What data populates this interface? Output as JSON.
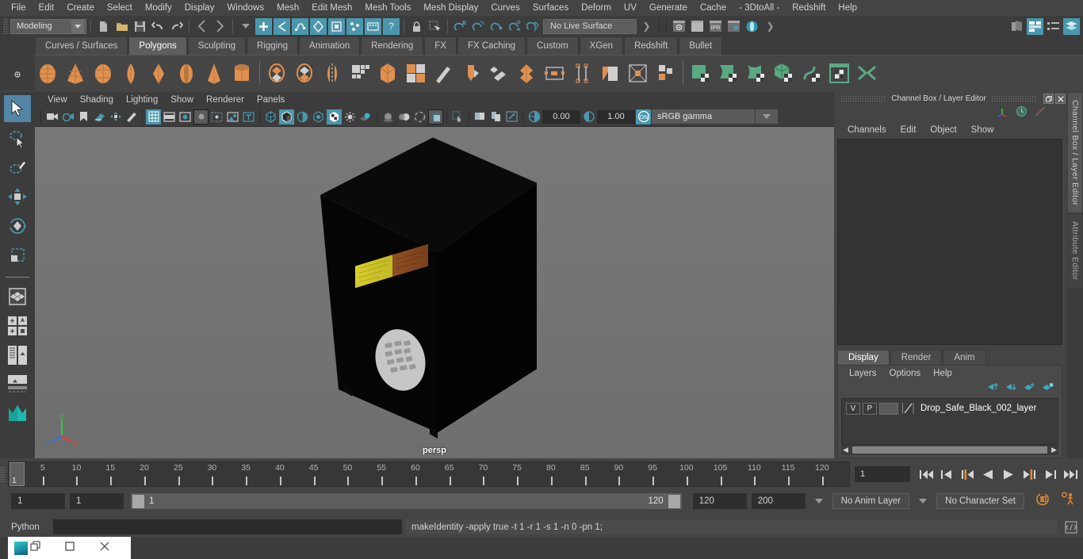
{
  "app": {
    "title": "Autodesk Maya"
  },
  "menubar": {
    "items": [
      "File",
      "Edit",
      "Create",
      "Select",
      "Modify",
      "Display",
      "Windows",
      "Mesh",
      "Edit Mesh",
      "Mesh Tools",
      "Mesh Display",
      "Curves",
      "Surfaces",
      "Deform",
      "UV",
      "Generate",
      "Cache",
      "- 3DtoAll -",
      "Redshift",
      "Help"
    ]
  },
  "statusline": {
    "menuset": "Modeling",
    "live_surface": "No Live Surface",
    "icons": [
      "new-scene-icon",
      "open-scene-icon",
      "save-scene-icon",
      "undo-icon",
      "redo-icon",
      "select-by-hierarchy-icon",
      "select-by-object-icon",
      "select-by-component-icon",
      "mode-dropdown-icon",
      "select-handles-icon",
      "select-points-icon",
      "select-lines-icon",
      "select-faces-icon",
      "select-uvs-icon",
      "select-all-icon",
      "select-misc-icon",
      "select-help-icon",
      "lock-icon",
      "select-region-icon",
      "snap-grid-icon",
      "snap-curve-icon",
      "snap-point-icon",
      "snap-projected-icon",
      "snap-view-icon",
      "render-current-frame-icon",
      "render-sequence-icon",
      "ipr-render-icon",
      "render-settings-icon",
      "hypershade-icon",
      "outliner-toggle-icon",
      "attribute-editor-toggle-icon",
      "tool-settings-toggle-icon",
      "channel-box-toggle-icon"
    ]
  },
  "shelf": {
    "tabs": [
      "Curves / Surfaces",
      "Polygons",
      "Sculpting",
      "Rigging",
      "Animation",
      "Rendering",
      "FX",
      "FX Caching",
      "Custom",
      "XGen",
      "Redshift",
      "Bullet"
    ],
    "active_tab": "Polygons",
    "icons": [
      "poly-sphere-icon",
      "poly-cone-icon",
      "poly-cube-icon",
      "poly-cylinder-icon",
      "poly-plane-icon",
      "poly-torus-icon",
      "poly-pyramid-icon",
      "poly-pipe-icon",
      "poly-combine-icon",
      "poly-separate-icon",
      "poly-mirror-icon",
      "poly-smooth-icon",
      "poly-boolean-icon",
      "poly-reduce-icon",
      "poly-extrude-icon",
      "poly-bevel-icon",
      "poly-multicut-icon",
      "poly-target-weld-icon",
      "poly-quad-draw-icon",
      "poly-crease-icon",
      "poly-transfer-attrs-icon",
      "poly-uv-icon",
      "uv-editor-icon",
      "uv-snapshot-icon",
      "uv-planar-icon",
      "uv-cylindrical-icon",
      "uv-spherical-icon",
      "uv-automatic-icon",
      "uv-layout-icon",
      "uv-unfold-icon"
    ]
  },
  "toolbox": {
    "tools": [
      "select-tool",
      "lasso-select-tool",
      "paint-select-tool",
      "move-tool",
      "rotate-tool",
      "scale-tool",
      "last-tool-used",
      "single-view-layout",
      "four-view-layout",
      "persp-outliner-layout",
      "persp-graph-layout",
      "hypershade-layout",
      "maya-logo"
    ],
    "active": "select-tool"
  },
  "viewport": {
    "menu": [
      "View",
      "Shading",
      "Lighting",
      "Show",
      "Renderer",
      "Panels"
    ],
    "camera_label": "persp",
    "exposure": "0.00",
    "gamma": "1.00",
    "color_management": "sRGB gamma",
    "tool_icons": [
      "select-camera-icon",
      "bookmark-camera-icon",
      "image-plane-icon",
      "two-d-pan-zoom-icon",
      "grease-pencil-icon",
      "grid-toggle-icon",
      "film-gate-icon",
      "resolution-gate-icon",
      "gate-mask-icon",
      "film-origin-icon",
      "safe-action-icon",
      "xray-text-icon",
      "wireframe-icon",
      "smooth-shade-icon",
      "shaded-wireframe-icon",
      "textured-icon",
      "use-default-material-icon",
      "lighting-icon",
      "shadows-icon",
      "ao-icon",
      "motion-blur-icon",
      "multisample-icon",
      "isolate-select-icon",
      "xray-icon",
      "xray-joints-icon",
      "xray-active-components-icon",
      "exposure-icon",
      "gamma-icon",
      "color-management-icon"
    ],
    "axis_gizmo": {
      "x": "x",
      "y": "y",
      "z": "z"
    }
  },
  "channelbox": {
    "panel_title": "Channel Box / Layer Editor",
    "menu": [
      "Channels",
      "Edit",
      "Object",
      "Show"
    ],
    "toolbar_icons": [
      "axis-gizmo-icon",
      "clock-icon",
      "slash-icon"
    ],
    "window_buttons": [
      "restore-icon",
      "close-icon"
    ],
    "content": ""
  },
  "layer_editor": {
    "tabs": [
      "Display",
      "Render",
      "Anim"
    ],
    "active_tab": "Display",
    "menu": [
      "Layers",
      "Options",
      "Help"
    ],
    "buttons": [
      "move-layer-up-icon",
      "move-layer-down-icon",
      "new-layer-icon",
      "new-layer-from-selected-icon"
    ],
    "layers": [
      {
        "visibility": "V",
        "playback": "P",
        "shading": "",
        "name": "Drop_Safe_Black_002_layer"
      }
    ]
  },
  "right_tabs": [
    {
      "label": "Channel Box / Layer Editor",
      "active": true
    },
    {
      "label": "Attribute Editor",
      "active": false
    }
  ],
  "timeslider": {
    "start_tick": 1,
    "ticks": [
      5,
      10,
      15,
      20,
      25,
      30,
      35,
      40,
      45,
      50,
      55,
      60,
      65,
      70,
      75,
      80,
      85,
      90,
      95,
      100,
      105,
      110,
      115,
      120
    ],
    "current_frame_label": "1",
    "current_frame_field": "1",
    "playback_buttons": [
      "go-to-start-icon",
      "step-back-keyframe-icon",
      "step-back-frame-icon",
      "play-backwards-icon",
      "play-forwards-icon",
      "step-forward-frame-icon",
      "step-forward-keyframe-icon",
      "go-to-end-icon"
    ]
  },
  "rangeslider": {
    "anim_start": "1",
    "playback_start": "1",
    "range_left_label": "1",
    "range_right_label": "120",
    "playback_end": "120",
    "anim_end": "200",
    "anim_layer": "No Anim Layer",
    "character_set": "No Character Set",
    "right_icons": [
      "auto-keyframe-icon",
      "animation-preferences-icon"
    ]
  },
  "commandline": {
    "language": "Python",
    "input_value": "",
    "output": "makeIdentity -apply true -t 1 -r 1 -s 1 -n 0 -pn 1;",
    "script_editor_icon": "script-editor-icon"
  },
  "taskbar": {
    "window_icon": "maya-app-icon",
    "buttons": [
      "restore-window-icon",
      "maximize-window-icon",
      "close-window-icon"
    ]
  },
  "colors": {
    "accent_teal": "#4a97ad",
    "shelf_orange": "#e0914f",
    "shelf_green": "#5aa983",
    "bg_dark": "#444444",
    "viewport_bg": "#737373",
    "object_black": "#050505",
    "label_yellow": "#d8cd2a",
    "label_brown": "#8a4a22",
    "keypad_gray": "#c9c9c9"
  },
  "scene": {
    "object_name": "Drop_Safe_Black_002",
    "description": "black drop safe box with yellow/brown warning label and round keypad"
  }
}
